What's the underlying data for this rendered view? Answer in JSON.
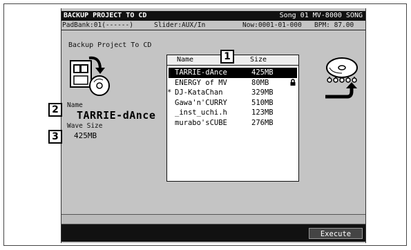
{
  "title": "BACKUP PROJECT TO CD",
  "song_info": "Song 01 MV-8000 SONG",
  "status": {
    "pad_bank": "PadBank:01(------)",
    "slider": "Slider:AUX/In",
    "now": "Now:0001-01-000",
    "bpm": "BPM: 87.00"
  },
  "page_title": "Backup Project To CD",
  "name_label": "Name",
  "name_value": "TARRIE-dAnce",
  "wave_size_label": "Wave Size",
  "wave_size_value": "425MB",
  "list": {
    "headers": {
      "name": "Name",
      "size": "Size"
    },
    "rows": [
      {
        "mark": "",
        "name": "TARRIE-dAnce",
        "size": "425MB",
        "locked": false,
        "selected": true
      },
      {
        "mark": "",
        "name": "ENERGY of MV",
        "size": "80MB",
        "locked": true,
        "selected": false
      },
      {
        "mark": "*",
        "name": "DJ-KataChan",
        "size": "329MB",
        "locked": false,
        "selected": false
      },
      {
        "mark": "",
        "name": "Gawa'n'CURRY",
        "size": "510MB",
        "locked": false,
        "selected": false
      },
      {
        "mark": "",
        "name": "_inst_uchi.h",
        "size": "123MB",
        "locked": false,
        "selected": false
      },
      {
        "mark": "",
        "name": "murabo'sCUBE",
        "size": "276MB",
        "locked": false,
        "selected": false
      }
    ]
  },
  "callouts": {
    "one": "1",
    "two": "2",
    "three": "3"
  },
  "progress": 0,
  "execute_label": "Execute",
  "icons": {
    "backup": "project-to-cd-icon",
    "cd_write": "cd-burn-icon",
    "lock": "lock-icon"
  }
}
